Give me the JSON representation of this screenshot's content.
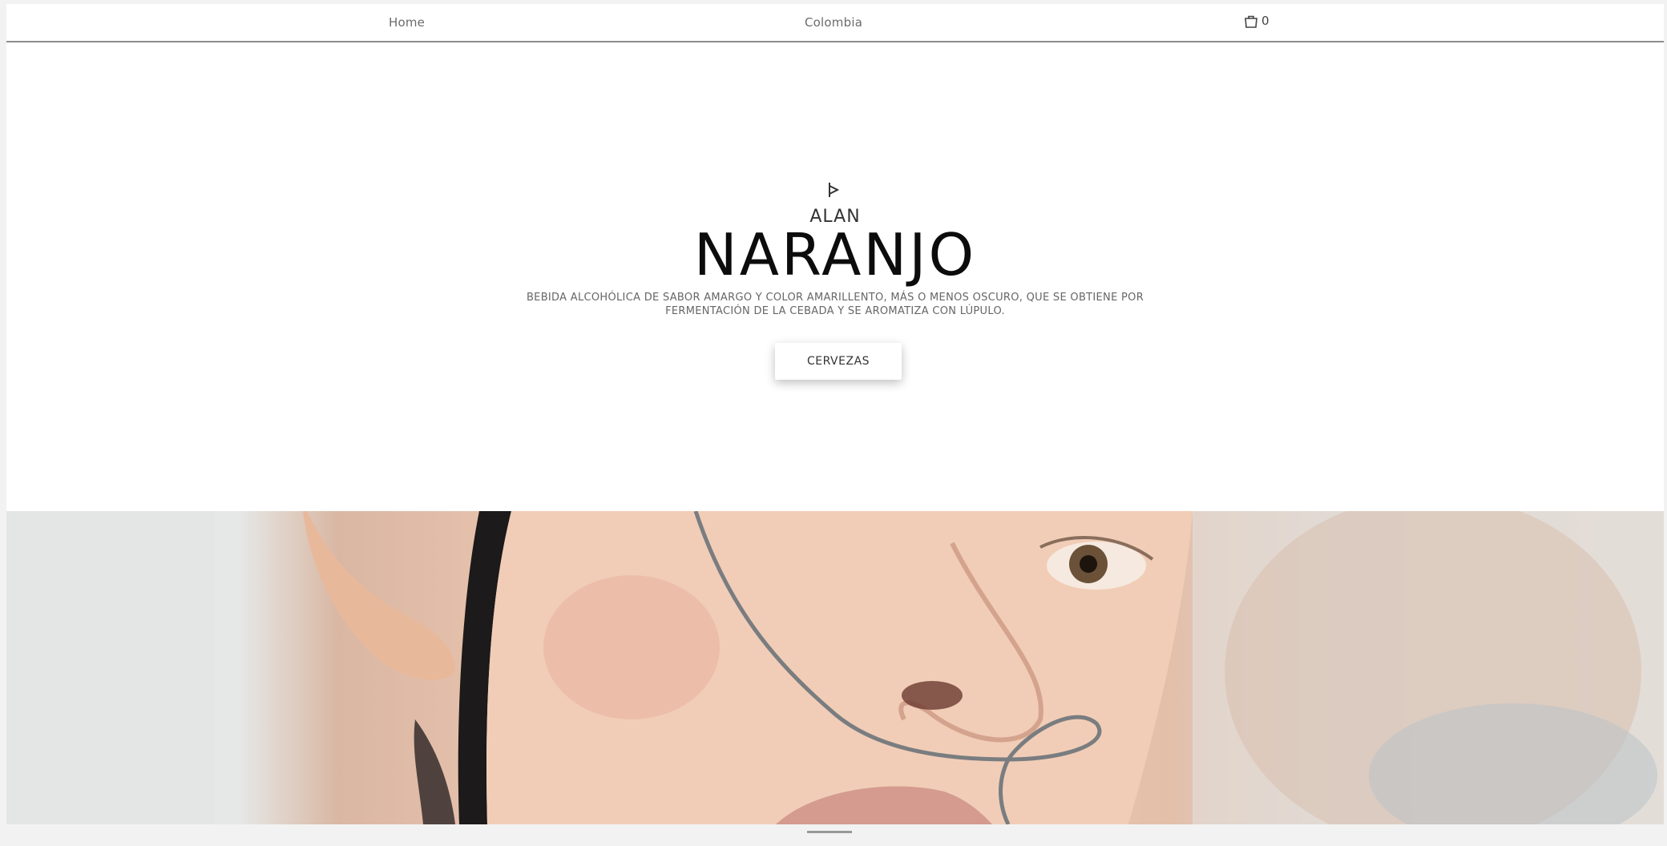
{
  "nav": {
    "home": "Home",
    "country": "Colombia",
    "cart_count": "0",
    "cart_icon": "shopping-bag-icon"
  },
  "hero": {
    "logo_icon": "play-logo-icon",
    "subtitle": "ALAN",
    "title": "NARANJO",
    "description": "BEBIDA ALCOHÓLICA DE SABOR AMARGO Y COLOR AMARILLENTO, MÁS O MENOS OSCURO, QUE SE OBTIENE POR FERMENTACIÓN DE LA CEBADA Y SE AROMATIZA CON LÚPULO.",
    "button_label": "CERVEZAS"
  },
  "colors": {
    "background": "#ffffff",
    "title": "#0c0c0c",
    "text": "#666666"
  }
}
